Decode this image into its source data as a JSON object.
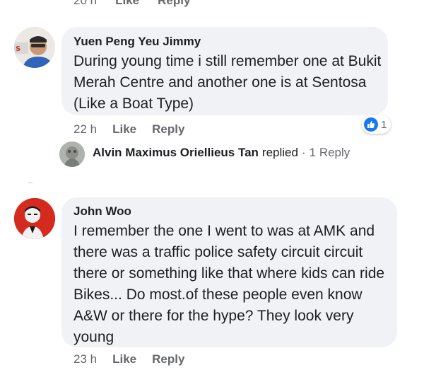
{
  "top_row": {
    "time": "20 h",
    "like": "Like",
    "reply": "Reply"
  },
  "comments": [
    {
      "author": "Yuen Peng Yeu Jimmy",
      "text": "During young time i still remember one at Bukit Merah Centre and another one is at Sentosa (Like a Boat Type)",
      "time": "22 h",
      "like": "Like",
      "reply": "Reply",
      "reaction_count": "1",
      "reply_summary": {
        "name": "Alvin Maximus Oriellieus Tan",
        "verb": "replied",
        "dot": "·",
        "count": "1 Reply"
      }
    },
    {
      "author": "John Woo",
      "text": "I remember the one I went to was at AMK and there was a traffic police safety circuit circuit there or something like that where kids can ride Bikes... Do most.of these people even know A&W or there for the hype? They look very young",
      "time": "23 h",
      "like": "Like",
      "reply": "Reply"
    }
  ],
  "colors": {
    "bubble": "#f0f2f5",
    "meta_text": "#65676b",
    "like_blue": "#1877f2",
    "avatar_red": "#d52b1e"
  },
  "icons": [
    "thumbs-up-icon"
  ]
}
